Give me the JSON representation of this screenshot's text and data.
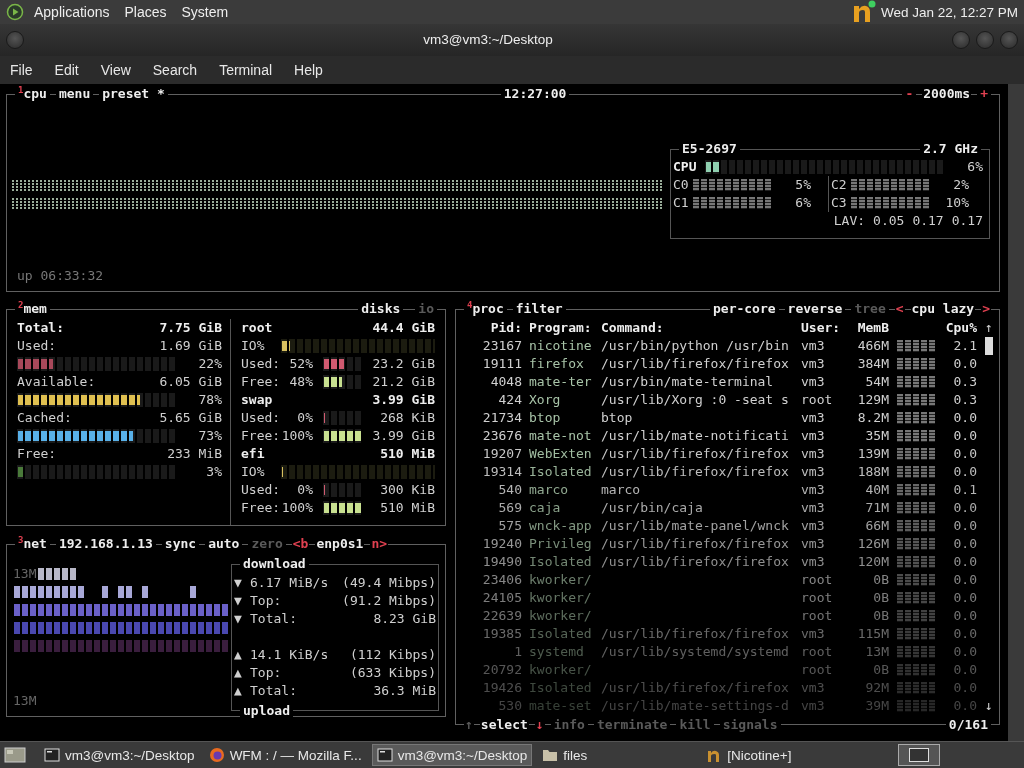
{
  "top_panel": {
    "menus": [
      "Applications",
      "Places",
      "System"
    ],
    "clock": "Wed Jan 22, 12:27 PM"
  },
  "window": {
    "title": "vm3@vm3:~/Desktop",
    "menu": [
      "File",
      "Edit",
      "View",
      "Search",
      "Terminal",
      "Help"
    ]
  },
  "cpu": {
    "title": "$^{1}$cpu",
    "tabs": [
      "menu",
      "preset *"
    ],
    "time": "12:27:00",
    "interval": {
      "minus": "-",
      "value": "2000ms",
      "plus": "+"
    },
    "uptime": "up 06:33:32",
    "info": {
      "model": "E5-2697",
      "freq": "2.7 GHz",
      "total": {
        "label": "CPU",
        "level": 0.06,
        "percent": "6%"
      },
      "cores": [
        {
          "label": "C0",
          "percent": "5%"
        },
        {
          "label": "C2",
          "percent": "2%"
        },
        {
          "label": "C1",
          "percent": "6%"
        },
        {
          "label": "C3",
          "percent": "10%"
        }
      ],
      "load_label": "LAV:",
      "load": [
        "0.05",
        "0.17",
        "0.17"
      ]
    }
  },
  "mem": {
    "title": "$^{2}$mem",
    "total": {
      "label": "Total:",
      "value": "7.75 GiB"
    },
    "items": [
      {
        "label": "Used:",
        "value": "1.69 GiB",
        "level": 0.22,
        "percent": "22%",
        "color": "#a8485a"
      },
      {
        "label": "Available:",
        "value": "6.05 GiB",
        "level": 0.78,
        "percent": "78%",
        "color": "#e0c050"
      },
      {
        "label": "Cached:",
        "value": "5.65 GiB",
        "level": 0.73,
        "percent": "73%",
        "color": "#58b0e8"
      },
      {
        "label": "Free:",
        "value": "233 MiB",
        "level": 0.03,
        "percent": "3%",
        "color": "#4a7a3a"
      }
    ]
  },
  "disks": {
    "title": "disks",
    "io_title": "io",
    "items": [
      {
        "name": "root",
        "size": "44.4 GiB",
        "io": {
          "label": "IO%",
          "level": 0.05
        },
        "used": {
          "label": "Used:",
          "percent": "52%",
          "level": 0.52,
          "value": "23.2 GiB"
        },
        "free": {
          "label": "Free:",
          "percent": "48%",
          "level": 0.48,
          "value": "21.2 GiB"
        }
      },
      {
        "name": "swap",
        "size": "3.99 GiB",
        "used": {
          "label": "Used:",
          "percent": "0%",
          "level": 0,
          "value": "268 KiB"
        },
        "free": {
          "label": "Free:",
          "percent": "100%",
          "level": 1,
          "value": "3.99 GiB"
        }
      },
      {
        "name": "efi",
        "size": "510 MiB",
        "io": {
          "label": "IO%",
          "level": 0
        },
        "used": {
          "label": "Used:",
          "percent": "0%",
          "level": 0,
          "value": "300 KiB"
        },
        "free": {
          "label": "Free:",
          "percent": "100%",
          "level": 1,
          "value": "510 MiB"
        }
      }
    ]
  },
  "net": {
    "title": "$^{3}$net",
    "address": "192.168.1.13",
    "toggles": [
      {
        "label": "sync",
        "active": true
      },
      {
        "label": "auto",
        "active": true
      },
      {
        "label": "zero",
        "active": false
      }
    ],
    "interface": {
      "prev": "<b",
      "name": "enp0s1",
      "next": "n>"
    },
    "scale_top": "13M",
    "scale_bottom": "13M",
    "download": {
      "title": "download",
      "rows": [
        {
          "arrow": "▼",
          "label": "6.17 MiB/s",
          "value": "(49.4 Mibps)"
        },
        {
          "arrow": "▼",
          "label": "Top:",
          "value": "(91.2 Mibps)"
        },
        {
          "arrow": "▼",
          "label": "Total:",
          "value": "8.23 GiB"
        }
      ]
    },
    "upload": {
      "title": "upload",
      "rows": [
        {
          "arrow": "▲",
          "label": "14.1 KiB/s",
          "value": "(112 Kibps)"
        },
        {
          "arrow": "▲",
          "label": "Top:",
          "value": "(633 Kibps)"
        },
        {
          "arrow": "▲",
          "label": "Total:",
          "value": "36.3 MiB"
        }
      ]
    }
  },
  "proc": {
    "title": "$^{4}$proc",
    "filter": "filter",
    "options": [
      {
        "label": "per-core",
        "active": true
      },
      {
        "label": "reverse",
        "active": true
      },
      {
        "label": "tree",
        "active": false
      }
    ],
    "sort": {
      "prev": "<",
      "label": "cpu lazy",
      "next": ">"
    },
    "columns": [
      "Pid:",
      "Program:",
      "Command:",
      "User:",
      "MemB",
      "Cpu%"
    ],
    "scroll_up": "↑",
    "scroll_down": "↓",
    "rows": [
      {
        "pid": "23167",
        "program": "nicotine",
        "command": "/usr/bin/python /usr/bin",
        "user": "vm3",
        "mem": "466M",
        "cpu": "2.1"
      },
      {
        "pid": "19111",
        "program": "firefox",
        "command": "/usr/lib/firefox/firefox",
        "user": "vm3",
        "mem": "384M",
        "cpu": "0.0"
      },
      {
        "pid": "4048",
        "program": "mate-ter",
        "command": "/usr/bin/mate-terminal",
        "user": "vm3",
        "mem": "54M",
        "cpu": "0.3"
      },
      {
        "pid": "424",
        "program": "Xorg",
        "command": "/usr/lib/Xorg :0 -seat s",
        "user": "root",
        "mem": "129M",
        "cpu": "0.3"
      },
      {
        "pid": "21734",
        "program": "btop",
        "command": "btop",
        "user": "vm3",
        "mem": "8.2M",
        "cpu": "0.0"
      },
      {
        "pid": "23676",
        "program": "mate-not",
        "command": "/usr/lib/mate-notificati",
        "user": "vm3",
        "mem": "35M",
        "cpu": "0.0"
      },
      {
        "pid": "19207",
        "program": "WebExten",
        "command": "/usr/lib/firefox/firefox",
        "user": "vm3",
        "mem": "139M",
        "cpu": "0.0"
      },
      {
        "pid": "19314",
        "program": "Isolated",
        "command": "/usr/lib/firefox/firefox",
        "user": "vm3",
        "mem": "188M",
        "cpu": "0.0"
      },
      {
        "pid": "540",
        "program": "marco",
        "command": "marco",
        "user": "vm3",
        "mem": "40M",
        "cpu": "0.1"
      },
      {
        "pid": "569",
        "program": "caja",
        "command": "/usr/bin/caja",
        "user": "vm3",
        "mem": "71M",
        "cpu": "0.0"
      },
      {
        "pid": "575",
        "program": "wnck-app",
        "command": "/usr/lib/mate-panel/wnck",
        "user": "vm3",
        "mem": "66M",
        "cpu": "0.0"
      },
      {
        "pid": "19240",
        "program": "Privileg",
        "command": "/usr/lib/firefox/firefox",
        "user": "vm3",
        "mem": "126M",
        "cpu": "0.0"
      },
      {
        "pid": "19490",
        "program": "Isolated",
        "command": "/usr/lib/firefox/firefox",
        "user": "vm3",
        "mem": "120M",
        "cpu": "0.0"
      },
      {
        "pid": "23406",
        "program": "kworker/",
        "user": "root",
        "mem": "0B",
        "cpu": "0.0"
      },
      {
        "pid": "24105",
        "program": "kworker/",
        "user": "root",
        "mem": "0B",
        "cpu": "0.0"
      },
      {
        "pid": "22639",
        "program": "kworker/",
        "user": "root",
        "mem": "0B",
        "cpu": "0.0"
      },
      {
        "pid": "19385",
        "program": "Isolated",
        "command": "/usr/lib/firefox/firefox",
        "user": "vm3",
        "mem": "115M",
        "cpu": "0.0"
      },
      {
        "pid": "1",
        "program": "systemd",
        "command": "/usr/lib/systemd/systemd",
        "user": "root",
        "mem": "13M",
        "cpu": "0.0"
      },
      {
        "pid": "20792",
        "program": "kworker/",
        "user": "root",
        "mem": "0B",
        "cpu": "0.0"
      },
      {
        "pid": "19426",
        "program": "Isolated",
        "command": "/usr/lib/firefox/firefox",
        "user": "vm3",
        "mem": "92M",
        "cpu": "0.0"
      },
      {
        "pid": "530",
        "program": "mate-set",
        "command": "/usr/lib/mate-settings-d",
        "user": "vm3",
        "mem": "39M",
        "cpu": "0.0"
      }
    ],
    "footer": {
      "select": {
        "up": "↑",
        "label": "select",
        "down": "↓"
      },
      "actions": [
        {
          "label": "info",
          "disabled": true
        },
        {
          "label": "terminate",
          "disabled": true
        },
        {
          "label": "kill",
          "disabled": true
        },
        {
          "label": "signals",
          "disabled": true
        }
      ],
      "count": "0/161"
    }
  },
  "taskbar": [
    {
      "kind": "terminal",
      "label": "vm3@vm3:~/Desktop",
      "selected": false
    },
    {
      "kind": "browser",
      "label": "WFM : / — Mozilla F...",
      "selected": false
    },
    {
      "kind": "terminal",
      "label": "vm3@vm3:~/Desktop",
      "selected": true
    },
    {
      "kind": "folder",
      "label": "files",
      "selected": false
    },
    {
      "kind": "nicotine",
      "label": "[Nicotine+]",
      "selected": false
    }
  ]
}
